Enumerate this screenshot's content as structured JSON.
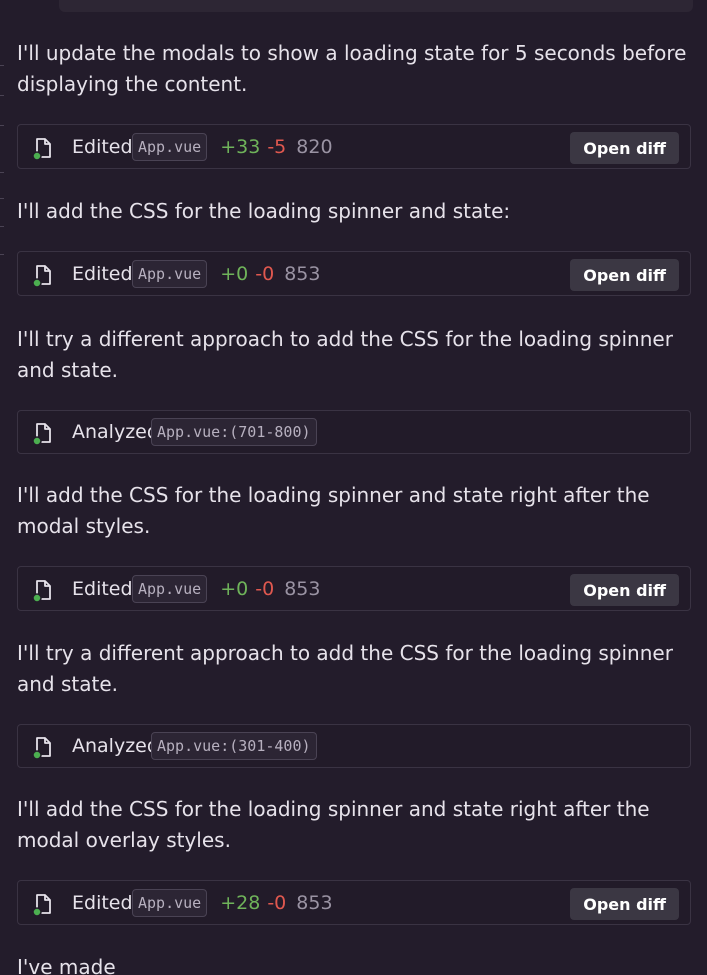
{
  "messages": [
    "I'll update the modals to show a loading state for 5 seconds before displaying the content.",
    "I'll add the CSS for the loading spinner and state:",
    "I'll try a different approach to add the CSS for the loading spinner and state.",
    "I'll add the CSS for the loading spinner and state right after the modal styles.",
    "I'll try a different approach to add the CSS for the loading spinner and state.",
    "I'll add the CSS for the loading spinner and state right after the modal overlay styles.",
    "I've made"
  ],
  "cards": [
    {
      "verb": "Edited",
      "file": "App.vue",
      "added": "+33",
      "removed": "-5",
      "total": "820",
      "action": "Open diff",
      "icon": "file-icon"
    },
    {
      "verb": "Edited",
      "file": "App.vue",
      "added": "+0",
      "removed": "-0",
      "total": "853",
      "action": "Open diff",
      "icon": "file-icon"
    },
    {
      "verb": "Analyzed",
      "file": "App.vue:(701-800)",
      "icon": "file-icon"
    },
    {
      "verb": "Edited",
      "file": "App.vue",
      "added": "+0",
      "removed": "-0",
      "total": "853",
      "action": "Open diff",
      "icon": "file-icon"
    },
    {
      "verb": "Analyzed",
      "file": "App.vue:(301-400)",
      "icon": "file-icon"
    },
    {
      "verb": "Edited",
      "file": "App.vue",
      "added": "+28",
      "removed": "-0",
      "total": "853",
      "action": "Open diff",
      "icon": "file-icon"
    }
  ],
  "colors": {
    "background": "#231c2b",
    "added": "#6fb35a",
    "removed": "#e0584f",
    "button": "#3b3743",
    "status_dot": "#4caf50"
  }
}
